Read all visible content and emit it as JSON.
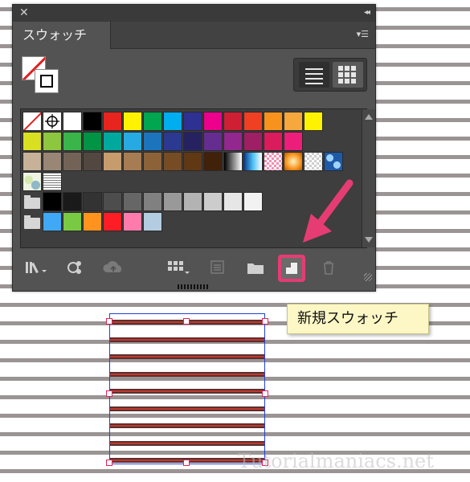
{
  "panel": {
    "close_glyph": "✕",
    "collapse_glyph": "◂◂",
    "tab_label": "スウォッチ",
    "menu_glyph": "▾☰"
  },
  "swatch_rows": [
    {
      "y": 0,
      "items": [
        {
          "kind": "none"
        },
        {
          "kind": "registration"
        },
        "#ffffff",
        "#000000",
        "#e8241f",
        "#fff200",
        "#00a650",
        "#00adef",
        "#2e3192",
        "#ec008c",
        "#ce1f35",
        "#ef4023",
        "#f7931d",
        "#f6a83c",
        "#fff200"
      ]
    },
    {
      "y": 1,
      "items": [
        "#d9e021",
        "#8dc63f",
        "#39b54a",
        "#009444",
        "#00a99d",
        "#27aae1",
        "#1c75bc",
        "#2b3990",
        "#262262",
        "#662d91",
        "#92278f",
        "#9e1f63",
        "#da1c5c",
        "#ed1e79"
      ]
    },
    {
      "y": 2,
      "items": [
        "#c7b299",
        "#998675",
        "#736357",
        "#534741",
        "#c69c6d",
        "#a67c52",
        "#8c6239",
        "#754c24",
        "#603813",
        "#42210b",
        {
          "kind": "gradient-bw"
        },
        {
          "kind": "gradient-blue"
        },
        {
          "kind": "pattern-pink"
        },
        {
          "kind": "gradient-orange"
        },
        {
          "kind": "pattern-check"
        },
        {
          "kind": "pattern-blue"
        }
      ]
    },
    {
      "y": 3,
      "items": [
        {
          "kind": "pattern-foliage"
        },
        {
          "kind": "pattern-lines"
        }
      ]
    },
    {
      "y": 4,
      "group": true,
      "items": [
        "#000000",
        "#1a1a1a",
        "#333333",
        "#4d4d4d",
        "#666666",
        "#808080",
        "#999999",
        "#b3b3b3",
        "#cccccc",
        "#e6e6e6",
        "#f2f2f2"
      ]
    },
    {
      "y": 5,
      "group": true,
      "items": [
        "#3fa9f5",
        "#7ac943",
        "#ff931e",
        "#ff1d25",
        "#ff7bac",
        "#b3cce0"
      ]
    }
  ],
  "tooltip": {
    "text": "新規スウォッチ"
  },
  "toolbar": {
    "library_icon": "swatch-libraries-menu-icon",
    "kind_icon": "show-swatch-kinds-icon",
    "cloud_icon": "cloud-icon",
    "options_icon": "swatch-options-icon",
    "group_icon": "new-color-group-icon",
    "new_icon": "new-swatch-icon",
    "delete_icon": "delete-swatch-icon"
  },
  "colors": {
    "highlight": "#e53c73",
    "panel_bg": "#535353",
    "selection": "#2340d6",
    "stripe": "#9a9494"
  },
  "watermark": "Tutorialmaniacs.net"
}
